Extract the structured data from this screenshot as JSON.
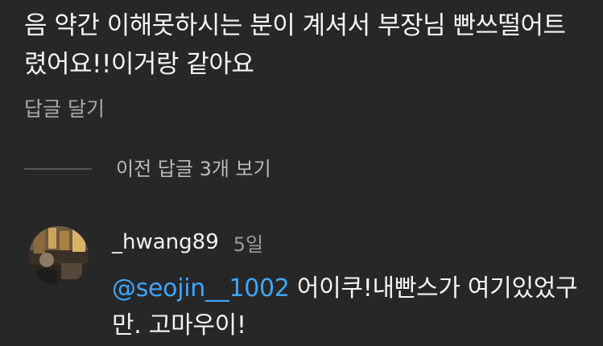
{
  "parent_comment": {
    "text": "음 약간 이해못하시는 분이 계셔서 부장님 빤쓰떨어트렸어요!!이거랑 같아요",
    "reply_label": "답글 달기"
  },
  "replies_toggle": {
    "label": "이전 답글 3개 보기"
  },
  "reply": {
    "author": "_hwang89",
    "age": "5일",
    "mention": "@seojin__1002",
    "text": " 어이쿠!내빤스가 여기있었구만. 고마우이!"
  },
  "colors": {
    "background": "#272727",
    "mention": "#3ea6ff",
    "secondary_text": "#a8a8a8"
  }
}
